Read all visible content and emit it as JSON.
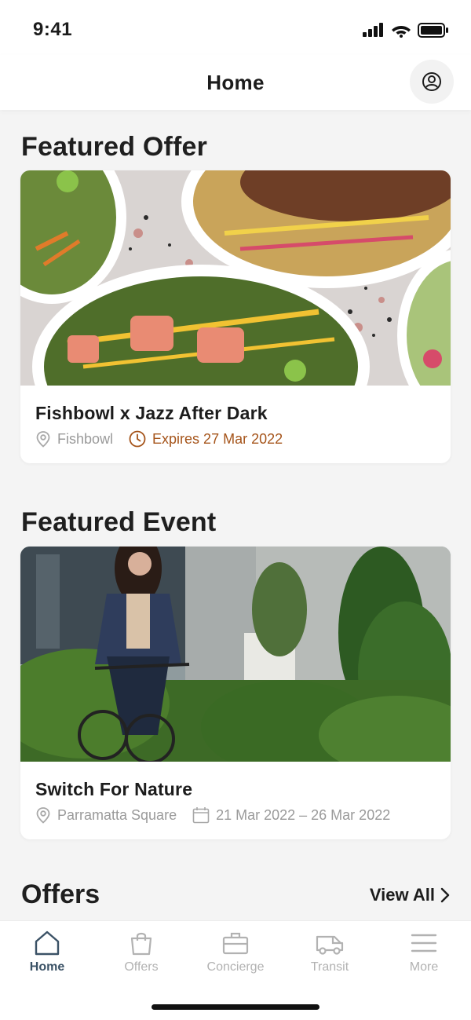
{
  "status_bar": {
    "time": "9:41"
  },
  "header": {
    "title": "Home"
  },
  "featured_offer": {
    "section_title": "Featured Offer",
    "title": "Fishbowl x Jazz After Dark",
    "location": "Fishbowl",
    "expiry": "Expires 27 Mar 2022",
    "expiry_color": "#a5541a"
  },
  "featured_event": {
    "section_title": "Featured Event",
    "title": "Switch For Nature",
    "location": "Parramatta Square",
    "dates": "21 Mar 2022 – 26 Mar 2022"
  },
  "offers_section": {
    "title": "Offers",
    "view_all": "View All"
  },
  "tab_bar": {
    "active_color": "#3b5266",
    "inactive_color": "#b2b2b2",
    "tabs": [
      {
        "label": "Home",
        "icon": "home-icon",
        "active": true
      },
      {
        "label": "Offers",
        "icon": "shopping-bag-icon",
        "active": false
      },
      {
        "label": "Concierge",
        "icon": "briefcase-icon",
        "active": false
      },
      {
        "label": "Transit",
        "icon": "van-icon",
        "active": false
      },
      {
        "label": "More",
        "icon": "menu-icon",
        "active": false
      }
    ]
  }
}
